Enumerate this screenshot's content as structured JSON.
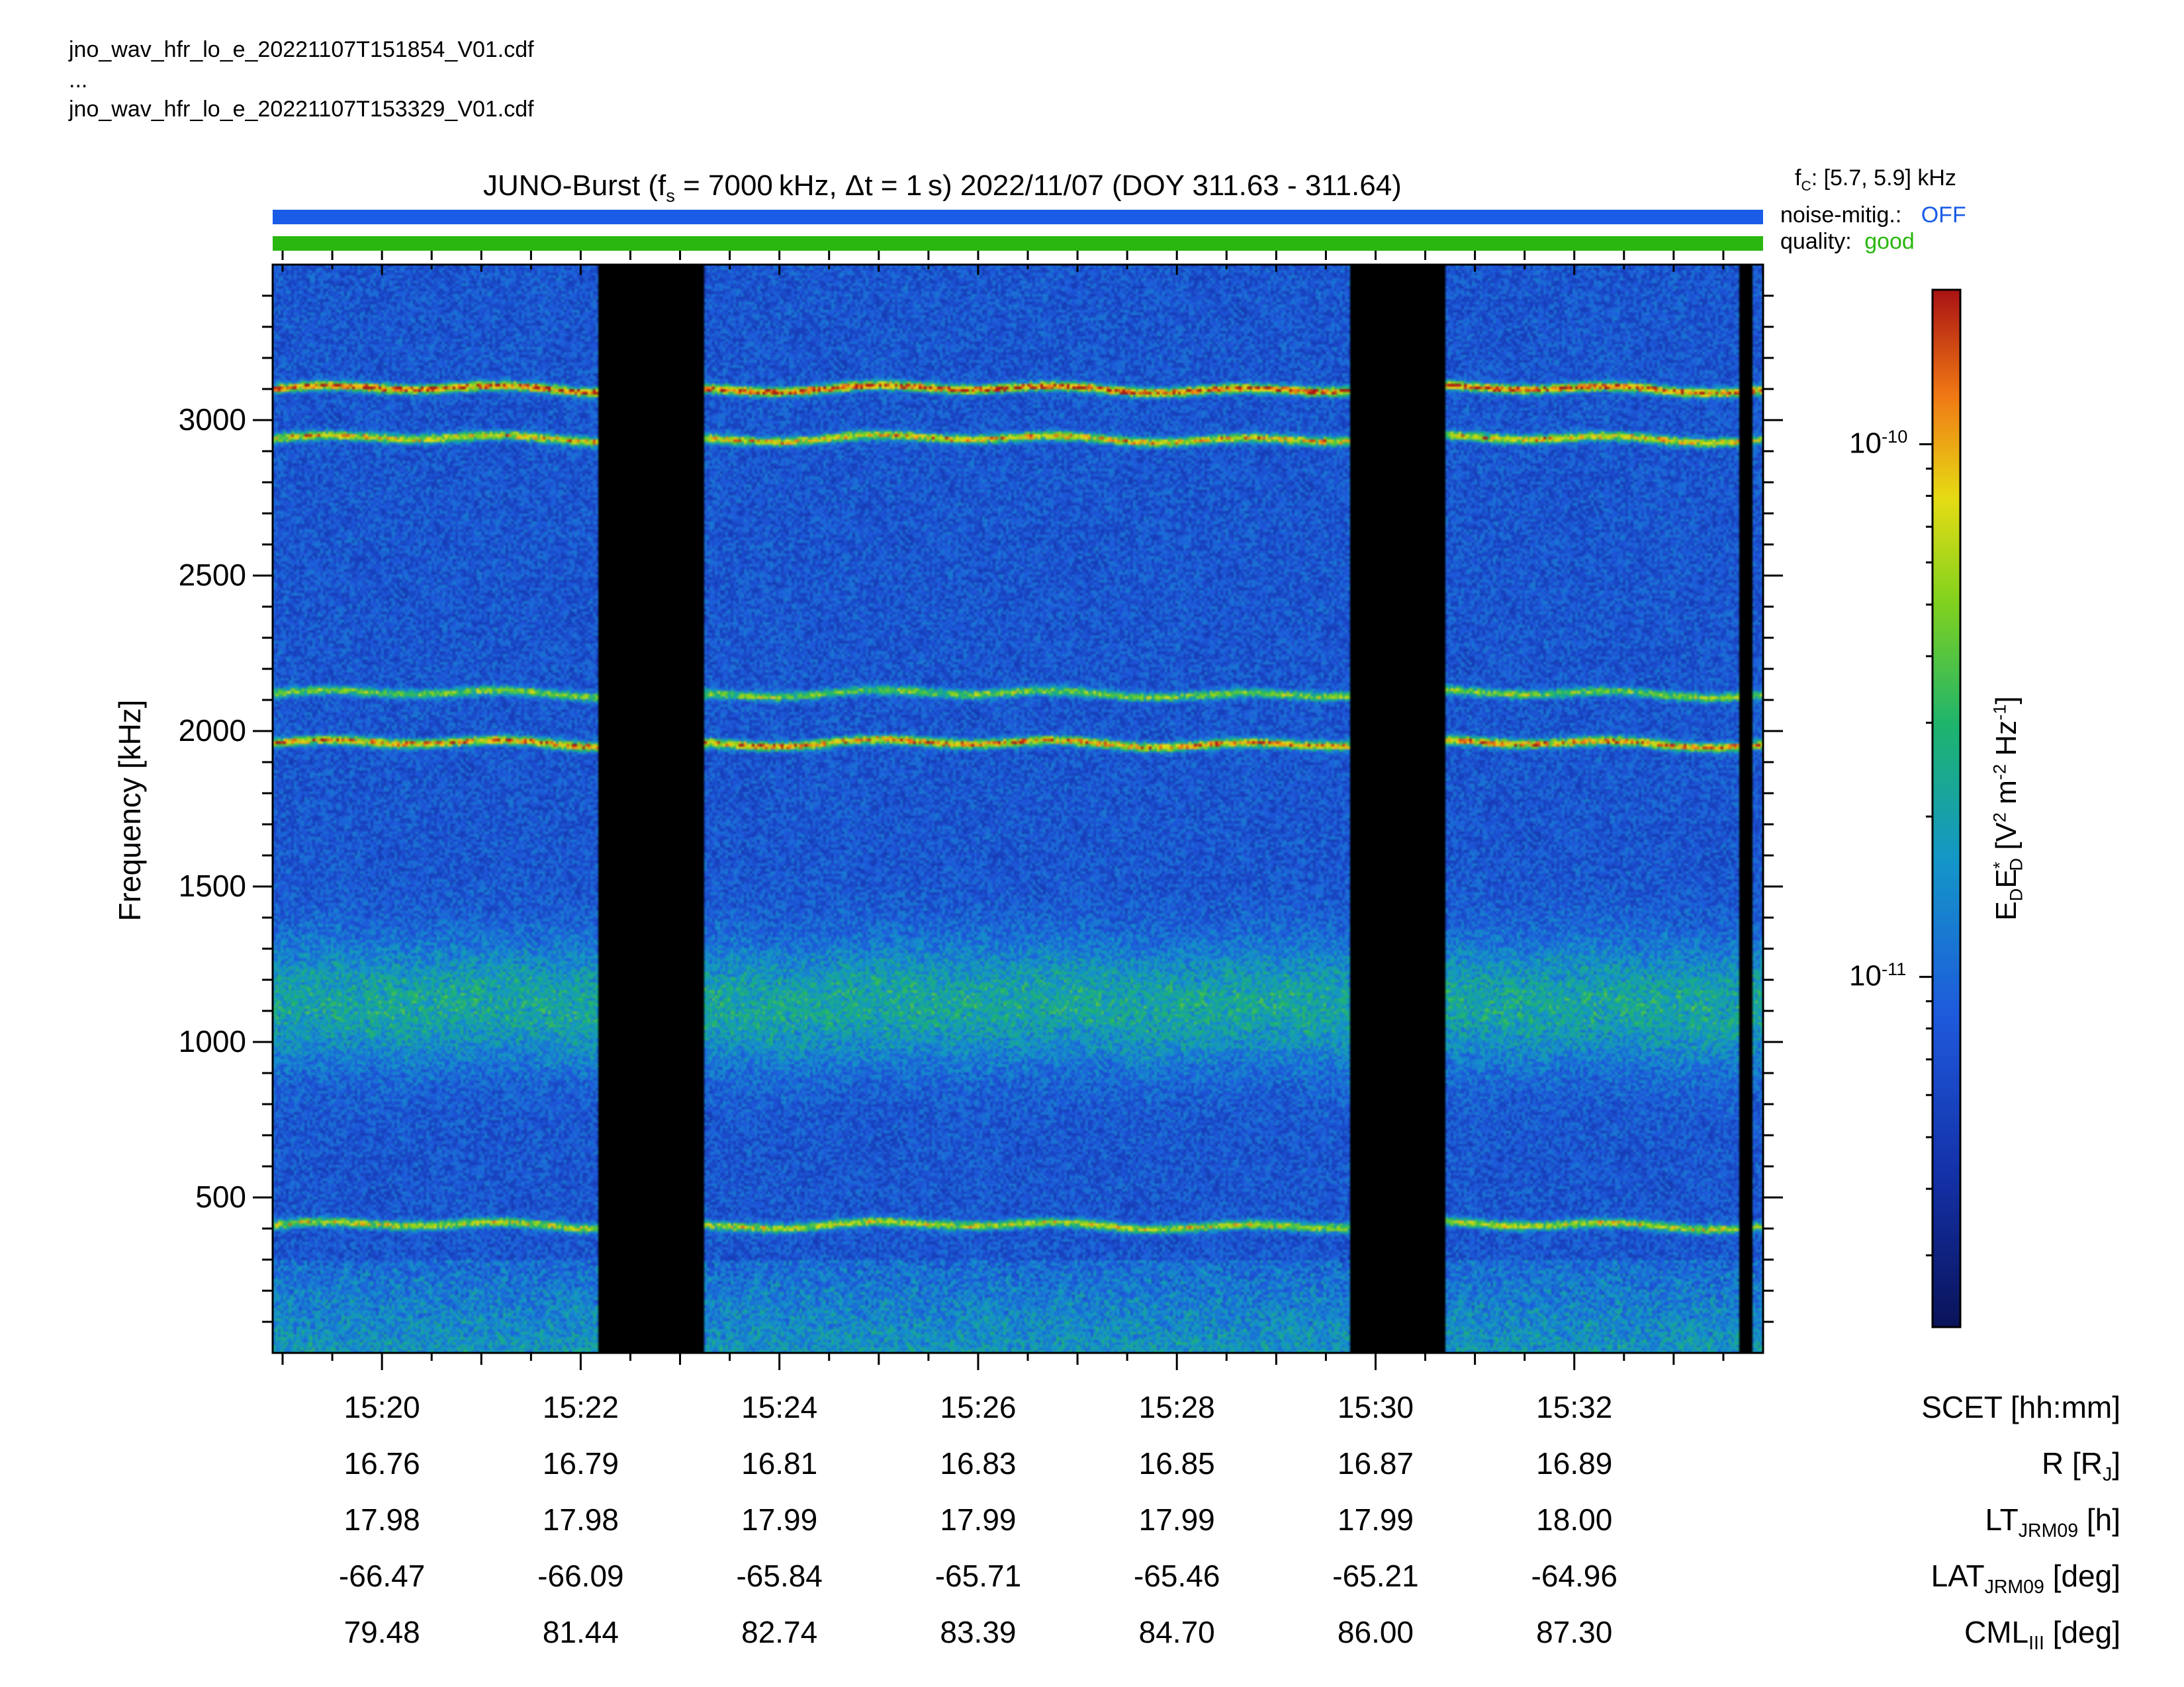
{
  "files": {
    "first": "jno_wav_hfr_lo_e_20221107T151854_V01.cdf",
    "ellipsis": "...",
    "last": "jno_wav_hfr_lo_e_20221107T153329_V01.cdf"
  },
  "title": {
    "prefix": "JUNO-Burst (f",
    "sub": "s",
    "suffix": " = 7000 kHz, Δt = 1 s)  2022/11/07 (DOY 311.63 - 311.64)"
  },
  "info": {
    "fc_label": "f",
    "fc_sub": "C",
    "fc_value": ": [5.7, 5.9] kHz",
    "noise_label": "noise-mitig.:",
    "noise_value": "OFF",
    "quality_label": "quality:",
    "quality_value": "good"
  },
  "colors": {
    "noise_bar": "#1a5ce8",
    "noise_text": "#1a5ce8",
    "quality_bar": "#2ab70f",
    "quality_text": "#2ab70f",
    "gap": "#000000"
  },
  "chart_data": {
    "type": "heatmap",
    "ylabel": "Frequency [kHz]",
    "yticks": [
      "500",
      "1000",
      "1500",
      "2000",
      "2500",
      "3000"
    ],
    "yvalues": [
      500,
      1000,
      1500,
      2000,
      2500,
      3000
    ],
    "ylim": [
      0,
      3500
    ],
    "x_start_time": "15:18:54",
    "x_end_time": "15:33:54",
    "x_ticks": [
      "15:20",
      "15:22",
      "15:24",
      "15:26",
      "15:28",
      "15:30",
      "15:32"
    ],
    "emission_bands_kHz": [
      {
        "freq": 3100,
        "intensity": 1.0
      },
      {
        "freq": 2940,
        "intensity": 0.8
      },
      {
        "freq": 2120,
        "intensity": 0.6
      },
      {
        "freq": 1960,
        "intensity": 0.9
      },
      {
        "freq": 1120,
        "intensity": 0.35
      },
      {
        "freq": 410,
        "intensity": 0.7
      }
    ],
    "data_gaps": [
      {
        "start": "15:22:11",
        "end": "15:23:15"
      },
      {
        "start": "15:29:44",
        "end": "15:30:42"
      },
      {
        "start": "15:33:40",
        "end": "15:33:47"
      }
    ],
    "colorbar": {
      "label_main": "E",
      "label_sub1": "D",
      "label_mid": "E",
      "label_sup1": "*",
      "label_sub2": "D",
      "label_units": " [V",
      "label_sup2": "2",
      "label_m": " m",
      "label_sup3": "-2",
      "label_hz": " Hz",
      "label_sup4": "-1",
      "label_end": "]",
      "scale": "log",
      "ticks": [
        {
          "base": "10",
          "exp": "-10",
          "value": 1e-10
        },
        {
          "base": "10",
          "exp": "-11",
          "value": 1e-11
        }
      ],
      "range": [
        2.2e-12,
        1.95e-10
      ]
    },
    "ephemeris": {
      "labels": [
        {
          "main": "SCET [hh:mm]",
          "sub": "",
          "tail": ""
        },
        {
          "main": "R [R",
          "sub": "J",
          "tail": "]"
        },
        {
          "main": "LT",
          "sub": "JRM09",
          "tail": " [h]"
        },
        {
          "main": "LAT",
          "sub": "JRM09",
          "tail": " [deg]"
        },
        {
          "main": "CML",
          "sub": "III",
          "tail": " [deg]"
        }
      ],
      "rows": [
        [
          "15:20",
          "15:22",
          "15:24",
          "15:26",
          "15:28",
          "15:30",
          "15:32"
        ],
        [
          "16.76",
          "16.79",
          "16.81",
          "16.83",
          "16.85",
          "16.87",
          "16.89"
        ],
        [
          "17.98",
          "17.98",
          "17.99",
          "17.99",
          "17.99",
          "17.99",
          "18.00"
        ],
        [
          "-66.47",
          "-66.09",
          "-65.84",
          "-65.71",
          "-65.46",
          "-65.21",
          "-64.96"
        ],
        [
          "79.48",
          "81.44",
          "82.74",
          "83.39",
          "84.70",
          "86.00",
          "87.30"
        ]
      ]
    }
  }
}
